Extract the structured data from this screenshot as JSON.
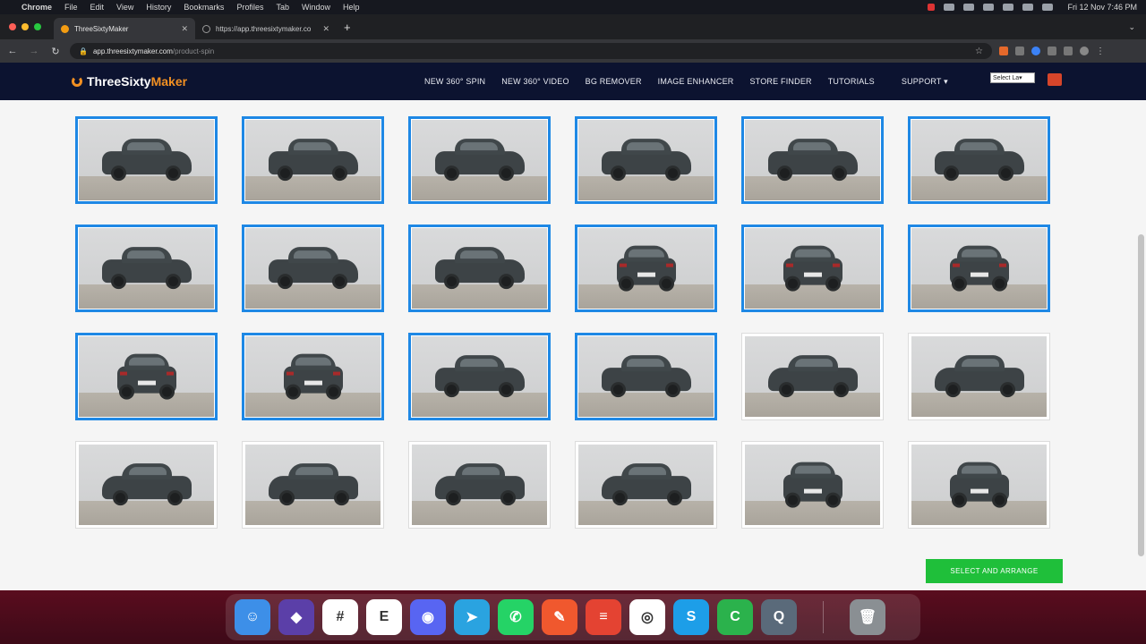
{
  "menubar": {
    "app": "Chrome",
    "items": [
      "File",
      "Edit",
      "View",
      "History",
      "Bookmarks",
      "Profiles",
      "Tab",
      "Window",
      "Help"
    ],
    "clock": "Fri 12 Nov  7:46 PM"
  },
  "browser": {
    "tabs": [
      {
        "title": "ThreeSixtyMaker",
        "active": true
      },
      {
        "title": "https://app.threesixtymaker.co",
        "active": false
      }
    ],
    "url_host": "app.threesixtymaker.com",
    "url_path": "/product-spin"
  },
  "site": {
    "logo_part1": "ThreeSixty",
    "logo_part2": "Maker",
    "nav": [
      "NEW 360° SPIN",
      "NEW 360° VIDEO",
      "BG REMOVER",
      "IMAGE ENHANCER",
      "STORE FINDER",
      "TUTORIALS"
    ],
    "support_label": "SUPPORT ▾",
    "language_select": "Select La▾"
  },
  "gallery": {
    "images": [
      {
        "view": "side-left",
        "selected": true
      },
      {
        "view": "side-left",
        "selected": true
      },
      {
        "view": "side-left",
        "selected": true
      },
      {
        "view": "side-left",
        "selected": true
      },
      {
        "view": "side-left",
        "selected": true
      },
      {
        "view": "side-left",
        "selected": true
      },
      {
        "view": "rear-left",
        "selected": true
      },
      {
        "view": "rear-left",
        "selected": true
      },
      {
        "view": "rear-left",
        "selected": true
      },
      {
        "view": "rear",
        "selected": true
      },
      {
        "view": "rear",
        "selected": true
      },
      {
        "view": "rear",
        "selected": true
      },
      {
        "view": "rear",
        "selected": true
      },
      {
        "view": "rear",
        "selected": true
      },
      {
        "view": "rear-right",
        "selected": true
      },
      {
        "view": "rear-right",
        "selected": true
      },
      {
        "view": "side-right",
        "selected": false
      },
      {
        "view": "side-right",
        "selected": false
      },
      {
        "view": "side-right",
        "selected": false
      },
      {
        "view": "side-right",
        "selected": false
      },
      {
        "view": "front-right",
        "selected": false
      },
      {
        "view": "front-right",
        "selected": false
      },
      {
        "view": "front",
        "selected": false
      },
      {
        "view": "front",
        "selected": false
      }
    ]
  },
  "actions": {
    "select_and_arrange": "SELECT AND ARRANGE"
  },
  "dock": [
    {
      "name": "finder",
      "color": "#3d8fe8",
      "glyph": "☺"
    },
    {
      "name": "obsidian",
      "color": "#5b3fa8",
      "glyph": "◆"
    },
    {
      "name": "slack",
      "color": "#ffffff",
      "glyph": "#"
    },
    {
      "name": "evernote",
      "color": "#ffffff",
      "glyph": "E"
    },
    {
      "name": "discord",
      "color": "#5865f2",
      "glyph": "◉"
    },
    {
      "name": "telegram",
      "color": "#2aa3e0",
      "glyph": "➤"
    },
    {
      "name": "whatsapp",
      "color": "#25d366",
      "glyph": "✆"
    },
    {
      "name": "pencil",
      "color": "#f0582e",
      "glyph": "✎"
    },
    {
      "name": "todoist",
      "color": "#e44332",
      "glyph": "≡"
    },
    {
      "name": "chrome",
      "color": "#ffffff",
      "glyph": "◎"
    },
    {
      "name": "skype",
      "color": "#1d9ee8",
      "glyph": "S"
    },
    {
      "name": "sheets",
      "color": "#2bb24c",
      "glyph": "C"
    },
    {
      "name": "quicktime",
      "color": "#5a6a7a",
      "glyph": "Q"
    }
  ]
}
